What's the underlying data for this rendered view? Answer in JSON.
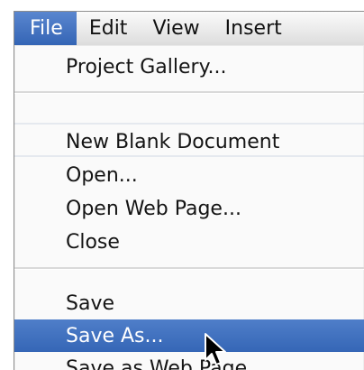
{
  "menubar": {
    "items": [
      {
        "label": "File",
        "active": true
      },
      {
        "label": "Edit",
        "active": false
      },
      {
        "label": "View",
        "active": false
      },
      {
        "label": "Insert",
        "active": false
      }
    ]
  },
  "file_menu": {
    "groups": [
      [
        "Project Gallery..."
      ],
      [
        "New Blank Document",
        "Open...",
        "Open Web Page...",
        "Close"
      ],
      [
        "Save",
        "Save As...",
        "Save as Web Page..."
      ]
    ],
    "highlighted_item": "Save As..."
  },
  "colors": {
    "highlight": "#3566b6",
    "menubar_active": "#4a78c4"
  },
  "icons": {
    "cursor": "arrow-cursor-icon"
  }
}
